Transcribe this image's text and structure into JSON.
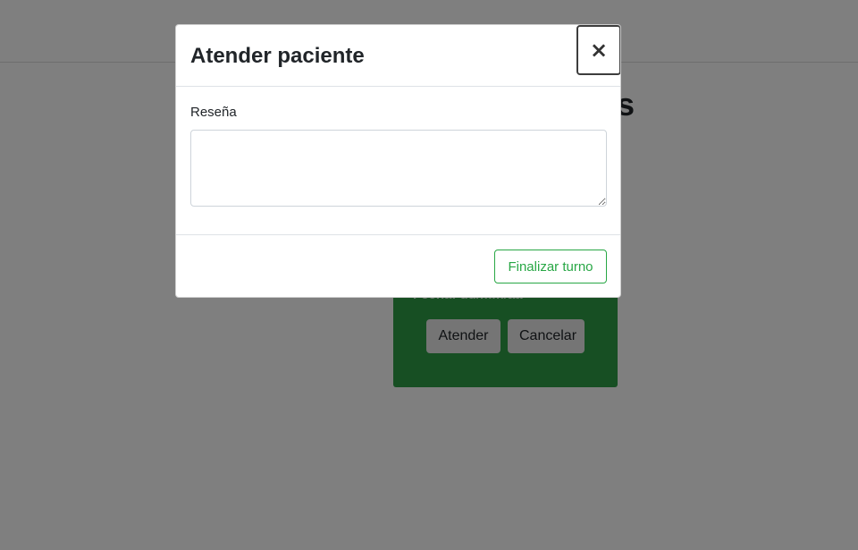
{
  "background": {
    "heading_fragment": "s",
    "card": {
      "date_text": "Fecha: dd/mm/aa",
      "attend_label": "Atender",
      "cancel_label": "Cancelar",
      "color": "#2e9e47"
    }
  },
  "modal": {
    "title": "Atender paciente",
    "close_label": "×",
    "review_label": "Reseña",
    "review_value": "",
    "finish_label": "Finalizar turno",
    "accent_color": "#28a745"
  }
}
